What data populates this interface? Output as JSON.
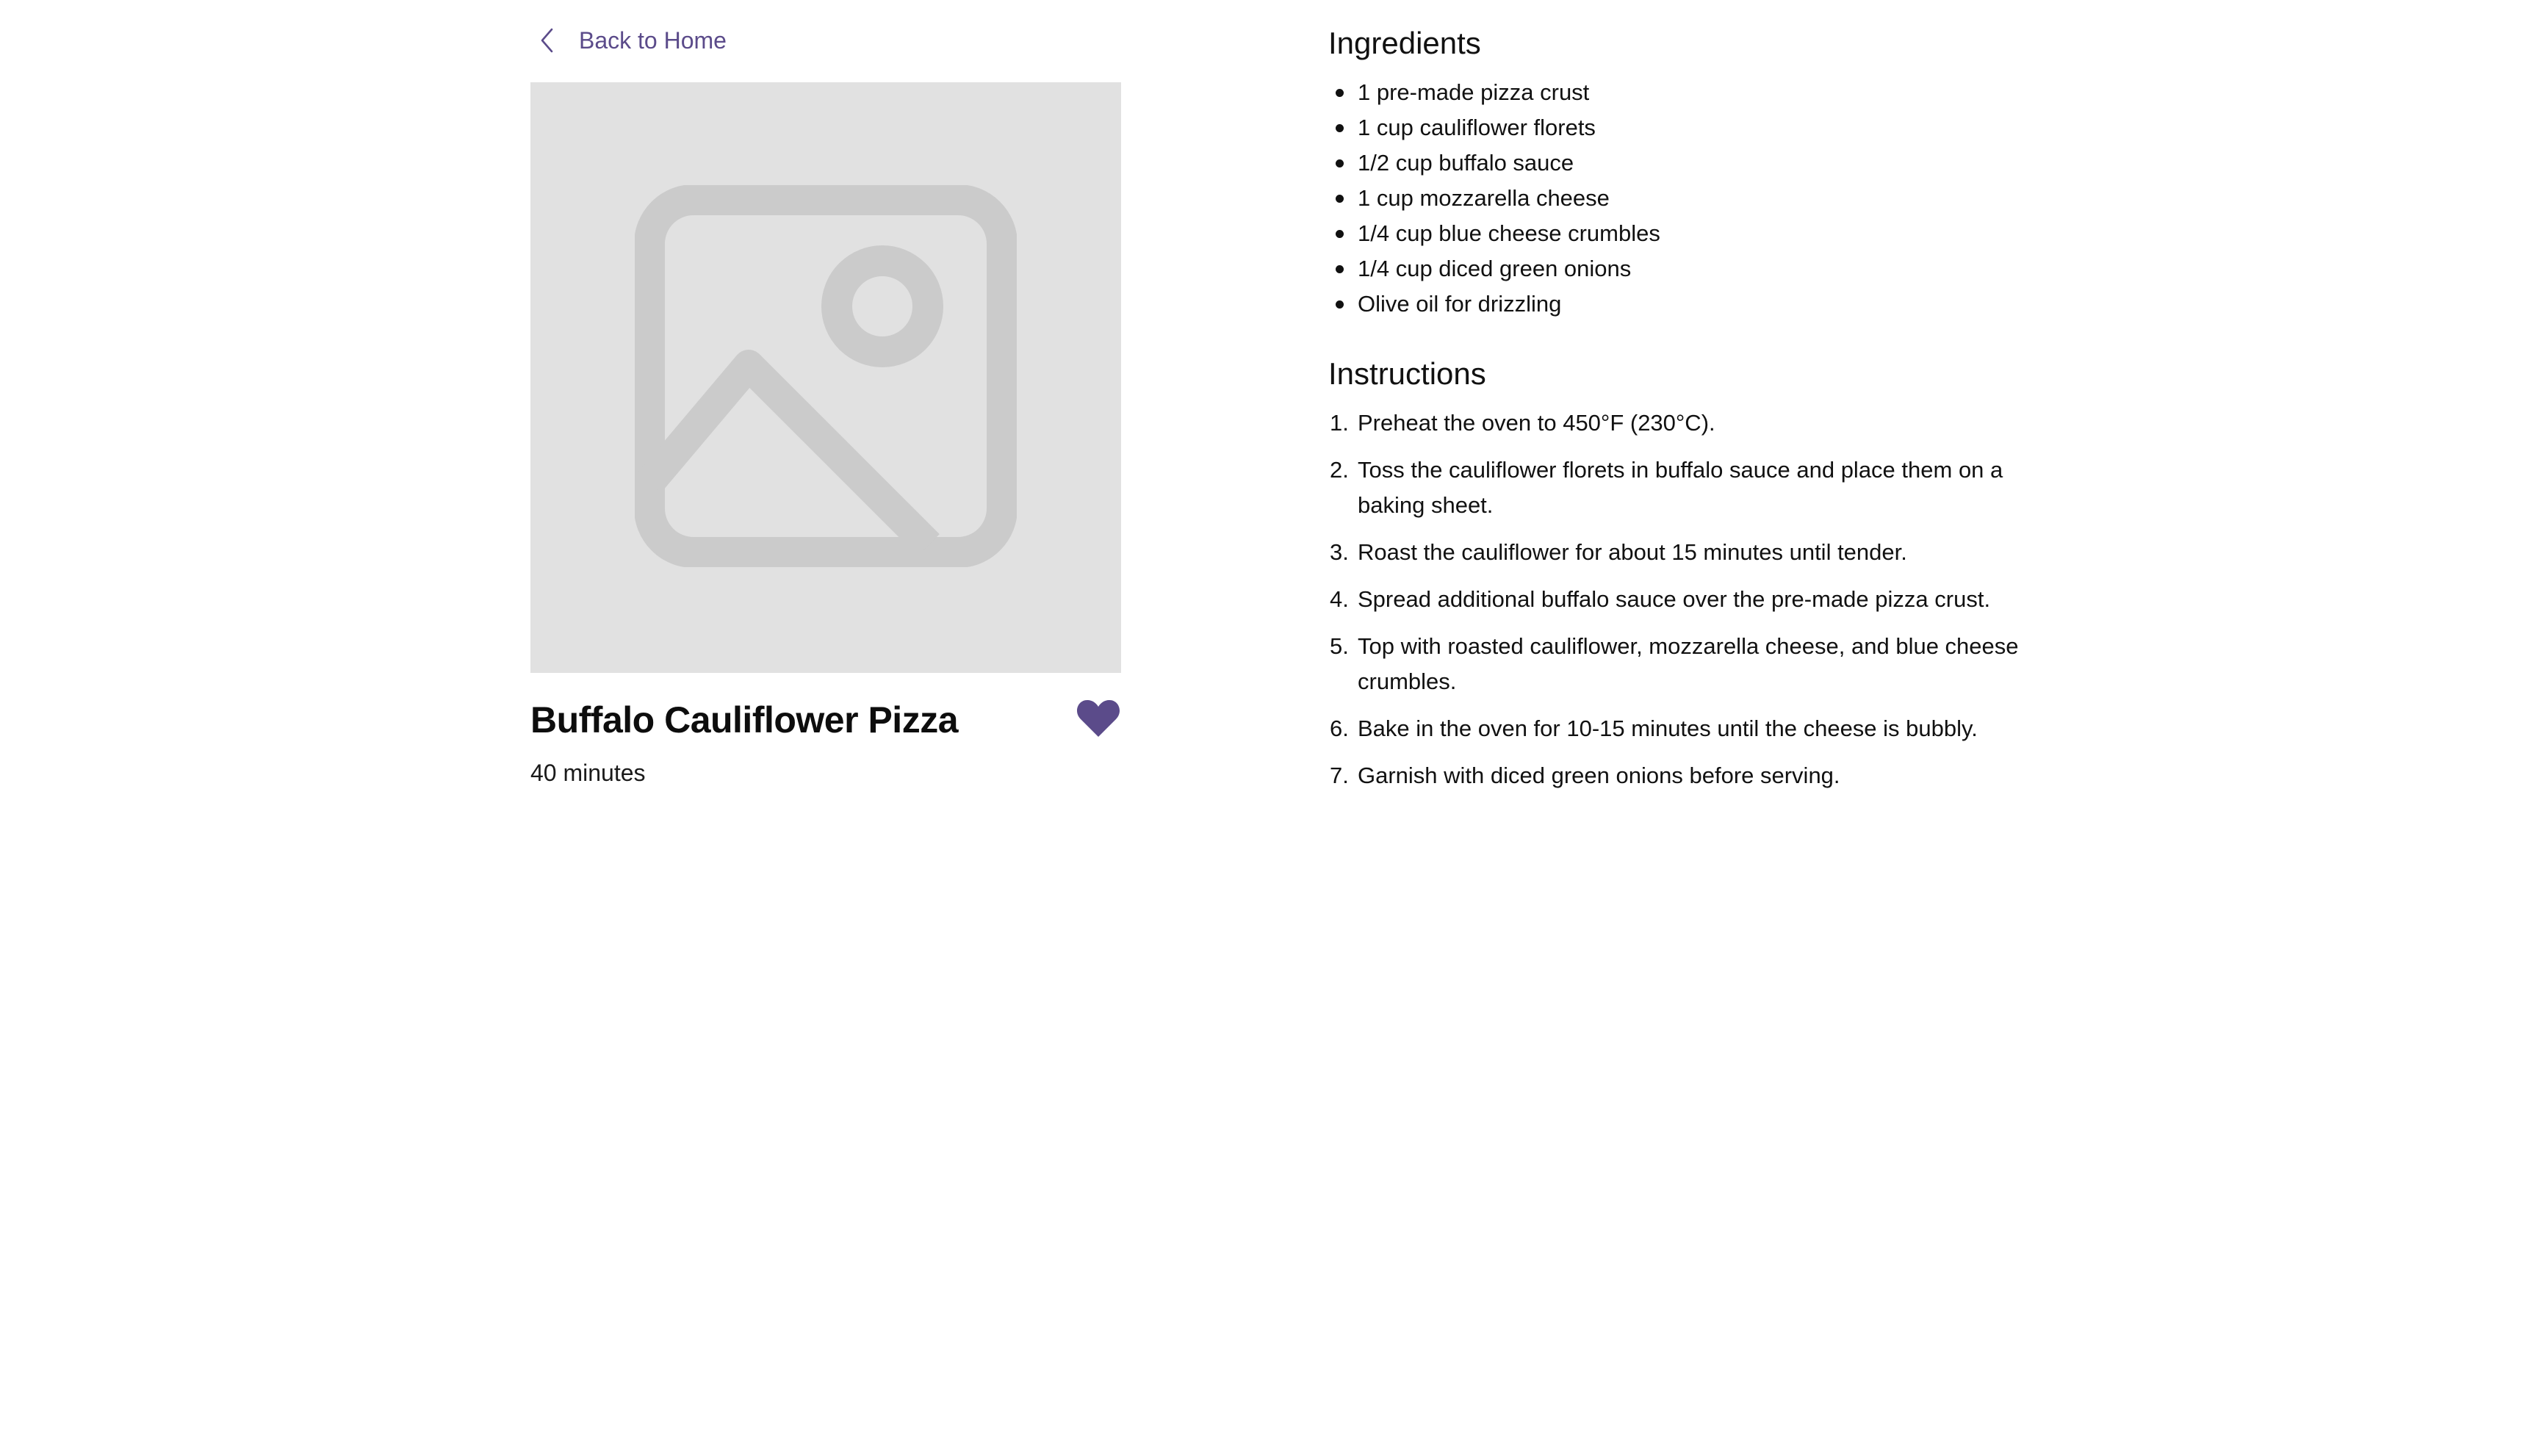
{
  "nav": {
    "back_label": "Back to Home"
  },
  "recipe": {
    "title": "Buffalo Cauliflower Pizza",
    "duration": "40 minutes",
    "image_icon": "image-placeholder-icon",
    "favorite_icon": "heart-icon",
    "favorite_color": "#5b4b8a"
  },
  "ingredients": {
    "heading": "Ingredients",
    "items": [
      "1 pre-made pizza crust",
      "1 cup cauliflower florets",
      "1/2 cup buffalo sauce",
      "1 cup mozzarella cheese",
      "1/4 cup blue cheese crumbles",
      "1/4 cup diced green onions",
      "Olive oil for drizzling"
    ]
  },
  "instructions": {
    "heading": "Instructions",
    "steps": [
      {
        "number": "1.",
        "text": "Preheat the oven to 450°F (230°C)."
      },
      {
        "number": "2.",
        "text": "Toss the cauliflower florets in buffalo sauce and place them on a baking sheet."
      },
      {
        "number": "3.",
        "text": "Roast the cauliflower for about 15 minutes until tender."
      },
      {
        "number": "4.",
        "text": "Spread additional buffalo sauce over the pre-made pizza crust."
      },
      {
        "number": "5.",
        "text": "Top with roasted cauliflower, mozzarella cheese, and blue cheese crumbles."
      },
      {
        "number": "6.",
        "text": "Bake in the oven for 10-15 minutes until the cheese is bubbly."
      },
      {
        "number": "7.",
        "text": "Garnish with diced green onions before serving."
      }
    ]
  },
  "colors": {
    "accent": "#5b4b8a",
    "placeholder_bg": "#e1e1e1",
    "placeholder_icon": "#cbcbcb"
  }
}
